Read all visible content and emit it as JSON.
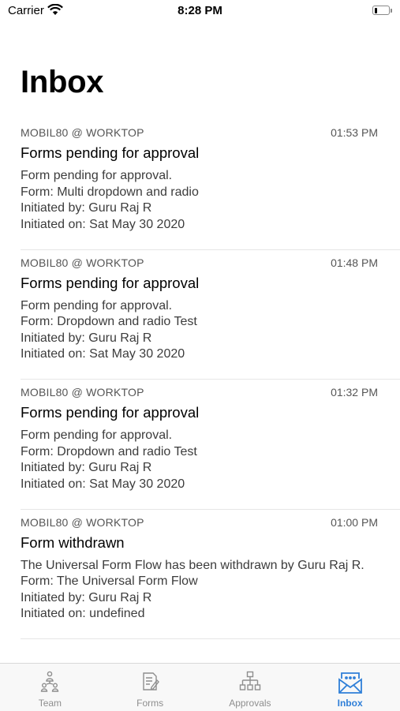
{
  "status_bar": {
    "carrier": "Carrier",
    "time": "8:28 PM",
    "battery_level": 0.2
  },
  "page": {
    "title": "Inbox"
  },
  "messages": [
    {
      "source": "MOBIL80 @ WORKTOP",
      "time": "01:53 PM",
      "subject": "Forms pending for approval",
      "body": "Form pending for approval.\n Form: Multi dropdown and radio\n Initiated by: Guru Raj R\n Initiated on: Sat May 30 2020"
    },
    {
      "source": "MOBIL80 @ WORKTOP",
      "time": "01:48 PM",
      "subject": "Forms pending for approval",
      "body": "Form pending for approval.\n Form: Dropdown and radio Test\n Initiated by: Guru Raj R\n Initiated on: Sat May 30 2020"
    },
    {
      "source": "MOBIL80 @ WORKTOP",
      "time": "01:32 PM",
      "subject": "Forms pending for approval",
      "body": "Form pending for approval.\n Form: Dropdown and radio Test\n Initiated by: Guru Raj R\n Initiated on: Sat May 30 2020"
    },
    {
      "source": "MOBIL80 @ WORKTOP",
      "time": "01:00 PM",
      "subject": "Form withdrawn",
      "body": "The Universal Form Flow has been withdrawn by Guru Raj R.\n Form: The Universal Form Flow\n Initiated by: Guru Raj R\n Initiated on: undefined"
    }
  ],
  "tab_bar": {
    "tabs": [
      {
        "label": "Team",
        "icon": "team-icon"
      },
      {
        "label": "Forms",
        "icon": "forms-icon"
      },
      {
        "label": "Approvals",
        "icon": "approvals-icon"
      },
      {
        "label": "Inbox",
        "icon": "inbox-icon",
        "active": true
      }
    ],
    "active_color": "#2f7fd8",
    "inactive_color": "#8e8e8e"
  }
}
